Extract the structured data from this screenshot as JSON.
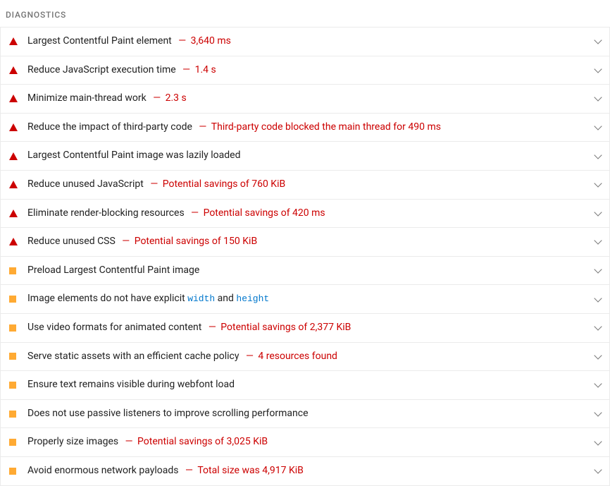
{
  "section_title": "DIAGNOSTICS",
  "audits": [
    {
      "severity": "fail",
      "title": "Largest Contentful Paint element",
      "metric": "3,640 ms"
    },
    {
      "severity": "fail",
      "title": "Reduce JavaScript execution time",
      "metric": "1.4 s"
    },
    {
      "severity": "fail",
      "title": "Minimize main-thread work",
      "metric": "2.3 s"
    },
    {
      "severity": "fail",
      "title": "Reduce the impact of third-party code",
      "metric": "Third-party code blocked the main thread for 490 ms"
    },
    {
      "severity": "fail",
      "title": "Largest Contentful Paint image was lazily loaded",
      "metric": ""
    },
    {
      "severity": "fail",
      "title": "Reduce unused JavaScript",
      "metric": "Potential savings of 760 KiB"
    },
    {
      "severity": "fail",
      "title": "Eliminate render-blocking resources",
      "metric": "Potential savings of 420 ms"
    },
    {
      "severity": "fail",
      "title": "Reduce unused CSS",
      "metric": "Potential savings of 150 KiB"
    },
    {
      "severity": "warn",
      "title": "Preload Largest Contentful Paint image",
      "metric": ""
    },
    {
      "severity": "warn",
      "title_pre": "Image elements do not have explicit ",
      "code1": "width",
      "mid": " and ",
      "code2": "height",
      "metric": ""
    },
    {
      "severity": "warn",
      "title": "Use video formats for animated content",
      "metric": "Potential savings of 2,377 KiB"
    },
    {
      "severity": "warn",
      "title": "Serve static assets with an efficient cache policy",
      "metric": "4 resources found"
    },
    {
      "severity": "warn",
      "title": "Ensure text remains visible during webfont load",
      "metric": ""
    },
    {
      "severity": "warn",
      "title": "Does not use passive listeners to improve scrolling performance",
      "metric": ""
    },
    {
      "severity": "warn",
      "title": "Properly size images",
      "metric": "Potential savings of 3,025 KiB"
    },
    {
      "severity": "warn",
      "title": "Avoid enormous network payloads",
      "metric": "Total size was 4,917 KiB"
    }
  ]
}
